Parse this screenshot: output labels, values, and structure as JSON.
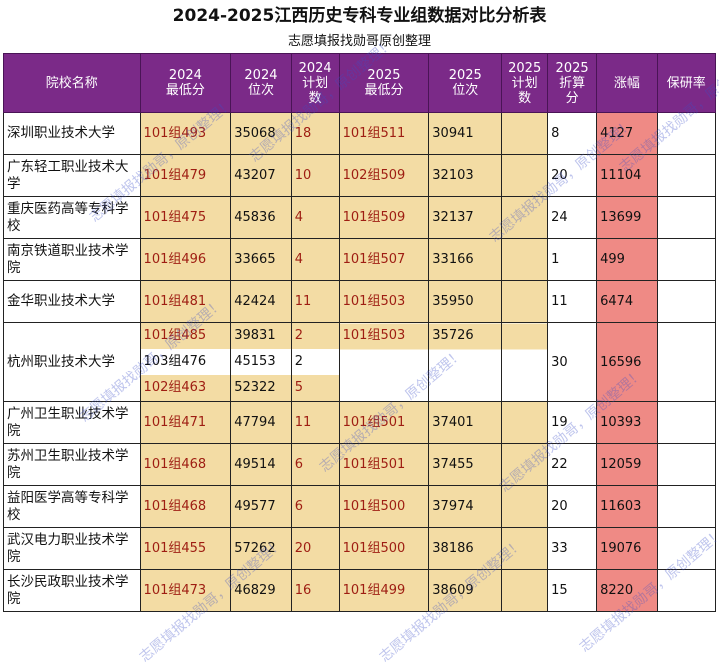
{
  "title": "2024-2025江西历史专科专业组数据对比分析表",
  "subtitle": "志愿填报找勋哥原创整理",
  "headers": {
    "school": "院校名称",
    "min2024": "2024\n最低分",
    "rank2024": "2024\n位次",
    "plan2024": "2024\n计划\n数",
    "min2025": "2025\n最低分",
    "rank2025": "2025\n位次",
    "plan2025": "2025\n计划\n数",
    "discount2025": "2025\n折算\n分",
    "rise": "涨幅",
    "ratio": "保研率"
  },
  "rows": [
    {
      "school": "深圳职业技术大学",
      "groups2024": [
        {
          "min": "101组493",
          "rank": "35068",
          "plan": "18"
        }
      ],
      "min2025": "101组511",
      "rank2025": "30941",
      "plan2025": "",
      "discount": "8",
      "rise": "4127",
      "ratio": ""
    },
    {
      "school": "广东轻工职业技术大学",
      "groups2024": [
        {
          "min": "101组479",
          "rank": "43207",
          "plan": "10"
        }
      ],
      "min2025": "102组509",
      "rank2025": "32103",
      "plan2025": "",
      "discount": "20",
      "rise": "11104",
      "ratio": ""
    },
    {
      "school": "重庆医药高等专科学校",
      "groups2024": [
        {
          "min": "101组475",
          "rank": "45836",
          "plan": "4"
        }
      ],
      "min2025": "101组509",
      "rank2025": "32137",
      "plan2025": "",
      "discount": "24",
      "rise": "13699",
      "ratio": ""
    },
    {
      "school": "南京铁道职业技术学院",
      "groups2024": [
        {
          "min": "101组496",
          "rank": "33665",
          "plan": "4"
        }
      ],
      "min2025": "101组507",
      "rank2025": "33166",
      "plan2025": "",
      "discount": "1",
      "rise": "499",
      "ratio": ""
    },
    {
      "school": "金华职业技术大学",
      "groups2024": [
        {
          "min": "101组481",
          "rank": "42424",
          "plan": "11"
        }
      ],
      "min2025": "101组503",
      "rank2025": "35950",
      "plan2025": "",
      "discount": "11",
      "rise": "6474",
      "ratio": ""
    },
    {
      "school": "杭州职业技术大学",
      "groups2024": [
        {
          "min": "101组485",
          "rank": "39831",
          "plan": "2"
        },
        {
          "min": "103组476",
          "rank": "45153",
          "plan": "2"
        },
        {
          "min": "102组463",
          "rank": "52322",
          "plan": "5"
        }
      ],
      "min2025": "101组503",
      "rank2025": "35726",
      "plan2025": "",
      "discount": "30",
      "rise": "16596",
      "ratio": ""
    },
    {
      "school": "广州卫生职业技术学院",
      "groups2024": [
        {
          "min": "101组471",
          "rank": "47794",
          "plan": "11"
        }
      ],
      "min2025": "101组501",
      "rank2025": "37401",
      "plan2025": "",
      "discount": "19",
      "rise": "10393",
      "ratio": ""
    },
    {
      "school": "苏州卫生职业技术学院",
      "groups2024": [
        {
          "min": "101组468",
          "rank": "49514",
          "plan": "6"
        }
      ],
      "min2025": "101组501",
      "rank2025": "37455",
      "plan2025": "",
      "discount": "22",
      "rise": "12059",
      "ratio": ""
    },
    {
      "school": "益阳医学高等专科学校",
      "groups2024": [
        {
          "min": "101组468",
          "rank": "49577",
          "plan": "6"
        }
      ],
      "min2025": "101组500",
      "rank2025": "37974",
      "plan2025": "",
      "discount": "20",
      "rise": "11603",
      "ratio": ""
    },
    {
      "school": "武汉电力职业技术学院",
      "groups2024": [
        {
          "min": "101组455",
          "rank": "57262",
          "plan": "20"
        }
      ],
      "min2025": "101组500",
      "rank2025": "38186",
      "plan2025": "",
      "discount": "33",
      "rise": "19076",
      "ratio": ""
    },
    {
      "school": "长沙民政职业技术学院",
      "groups2024": [
        {
          "min": "101组473",
          "rank": "46829",
          "plan": "16"
        }
      ],
      "min2025": "101组499",
      "rank2025": "38609",
      "plan2025": "",
      "discount": "15",
      "rise": "8220",
      "ratio": ""
    }
  ],
  "watermark": "志愿填报找勋哥，原创整理！"
}
